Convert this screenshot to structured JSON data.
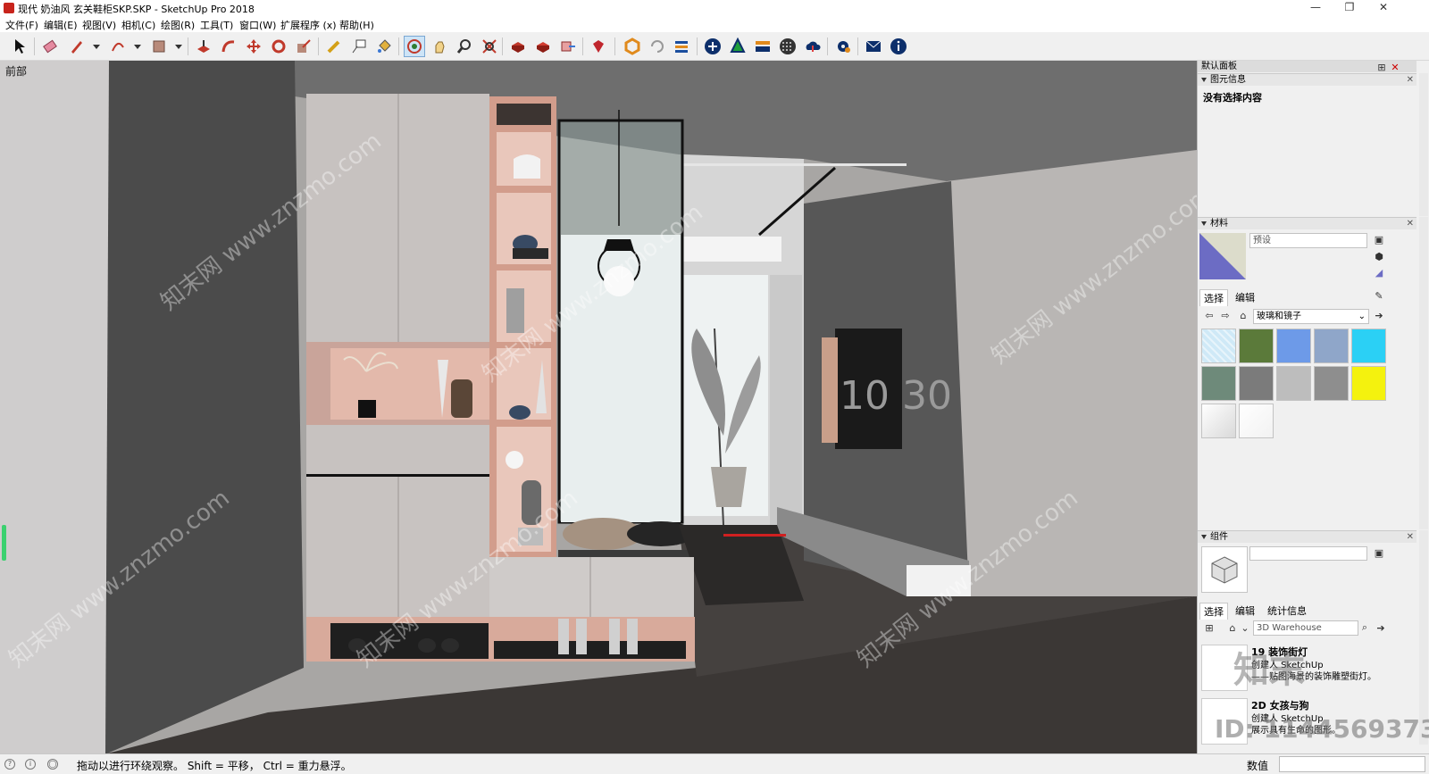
{
  "window": {
    "title": "现代 奶油风 玄关鞋柜SKP.SKP - SketchUp Pro 2018",
    "controls": {
      "minimize": "—",
      "restore": "❐",
      "close": "✕"
    }
  },
  "menu": [
    "文件(F)",
    "编辑(E)",
    "视图(V)",
    "相机(C)",
    "绘图(R)",
    "工具(T)",
    "窗口(W)",
    "扩展程序 (x)",
    "帮助(H)"
  ],
  "toolbar": {
    "active_tool": "orbit-tool",
    "tools": [
      "select",
      "eraser",
      "pencil",
      "arc",
      "rectangle",
      "push-pull",
      "follow-me",
      "move",
      "rotate",
      "scale",
      "tape-measure",
      "text",
      "paint-bucket",
      "orbit",
      "pan",
      "zoom",
      "zoom-extents",
      "warehouse",
      "extension-warehouse",
      "send-to-layout",
      "ruby",
      "sketchup-logo",
      "refresh",
      "layers",
      "add",
      "tree",
      "bars",
      "checker",
      "cloud",
      "settings",
      "mail",
      "info"
    ]
  },
  "viewport": {
    "scene_label": "前部",
    "tv_clock": "10 30",
    "watermark": "知末网 www.znzmo.com",
    "id_watermark": "ID: 1144569373",
    "logo": "知末"
  },
  "tray": {
    "title": "默认面板",
    "entity_info": {
      "header": "图元信息",
      "message": "没有选择内容"
    },
    "materials": {
      "header": "材料",
      "name_placeholder": "预设",
      "tabs": [
        "选择",
        "编辑"
      ],
      "library": "玻璃和镜子",
      "swatch_colors": [
        "#cfe9f7",
        "#5b7a3a",
        "#6d9ae8",
        "#8fa6c9",
        "#2bd0f5",
        "#6e8a7a",
        "#7b7b7b",
        "#bdbdbd",
        "#8e8e8e",
        "#f4f20e",
        "#d9d9d9",
        "#f2f2f2"
      ]
    },
    "components": {
      "header": "组件",
      "tabs": [
        "选择",
        "编辑",
        "统计信息"
      ],
      "search_placeholder": "3D Warehouse",
      "results": [
        {
          "title": "19 装饰街灯",
          "desc": "创建人 SketchUp",
          "desc2": "——贴图海景的装饰雕塑街灯。"
        },
        {
          "title": "2D 女孩与狗",
          "desc": "创建人 SketchUp",
          "desc2": "展示具有生命的图形。"
        }
      ]
    }
  },
  "status": {
    "message": "拖动以进行环绕观察。 Shift = 平移， Ctrl = 重力悬浮。",
    "measure_label": "数值",
    "measure_value": ""
  }
}
